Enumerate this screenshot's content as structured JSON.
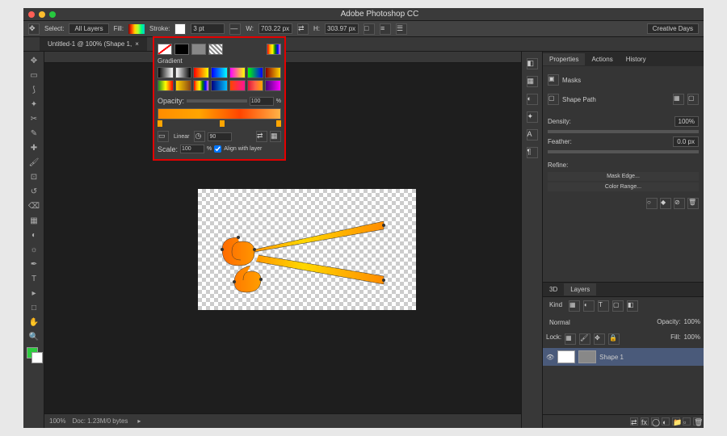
{
  "app": {
    "title": "Adobe Photoshop CC"
  },
  "doc": {
    "tab": "Untitled-1 @ 100% (Shape 1,"
  },
  "optbar": {
    "select": "Select:",
    "select_val": "All Layers",
    "fill": "Fill:",
    "stroke": "Stroke:",
    "stroke_w": "3 pt",
    "w_label": "W:",
    "w_val": "703.22 px",
    "h_label": "H:",
    "h_val": "303.97 px",
    "ws": "Creative Days"
  },
  "popover": {
    "gradient_label": "Gradient",
    "opacity_label": "Opacity:",
    "opacity_val": "100",
    "type": "Linear",
    "angle": "90",
    "scale_label": "Scale:",
    "scale_val": "100",
    "align": "Align with layer"
  },
  "props": {
    "tabs": [
      "Properties",
      "Actions",
      "History"
    ],
    "masks": "Masks",
    "shapepath": "Shape Path",
    "density": "Density:",
    "density_val": "100%",
    "feather": "Feather:",
    "feather_val": "0.0 px",
    "refine": "Refine:",
    "mask_edge": "Mask Edge...",
    "color_range": "Color Range..."
  },
  "layers": {
    "tabs": [
      "3D",
      "Layers"
    ],
    "kind": "Kind",
    "blend": "Normal",
    "opacity": "Opacity:",
    "opacity_val": "100%",
    "lock": "Lock:",
    "fill": "Fill:",
    "fill_val": "100%",
    "name": "Shape 1"
  },
  "status": {
    "zoom": "100%",
    "doc": "Doc: 1.23M/0 bytes"
  },
  "gradients": [
    "linear-gradient(90deg,#000,#fff)",
    "linear-gradient(90deg,#fff,#000)",
    "linear-gradient(90deg,#ff0000,#ffff00)",
    "linear-gradient(90deg,#0000ff,#00ffff)",
    "linear-gradient(90deg,#ff00ff,#ffff00)",
    "linear-gradient(90deg,#00ff00,#0000ff)",
    "linear-gradient(90deg,#8B0000,#FFD700)",
    "linear-gradient(90deg,#228B22,#FFFF00,#FF0000)",
    "linear-gradient(90deg,#FFD700,#8B4513)",
    "linear-gradient(90deg,red,orange,yellow,green,blue,violet)",
    "linear-gradient(90deg,#000080,#00BFFF)",
    "linear-gradient(90deg,#FF4500,#FF1493)",
    "linear-gradient(90deg,#DC143C,#FF6347,#FFA500)",
    "linear-gradient(90deg,#4B0082,#FF00FF)"
  ]
}
